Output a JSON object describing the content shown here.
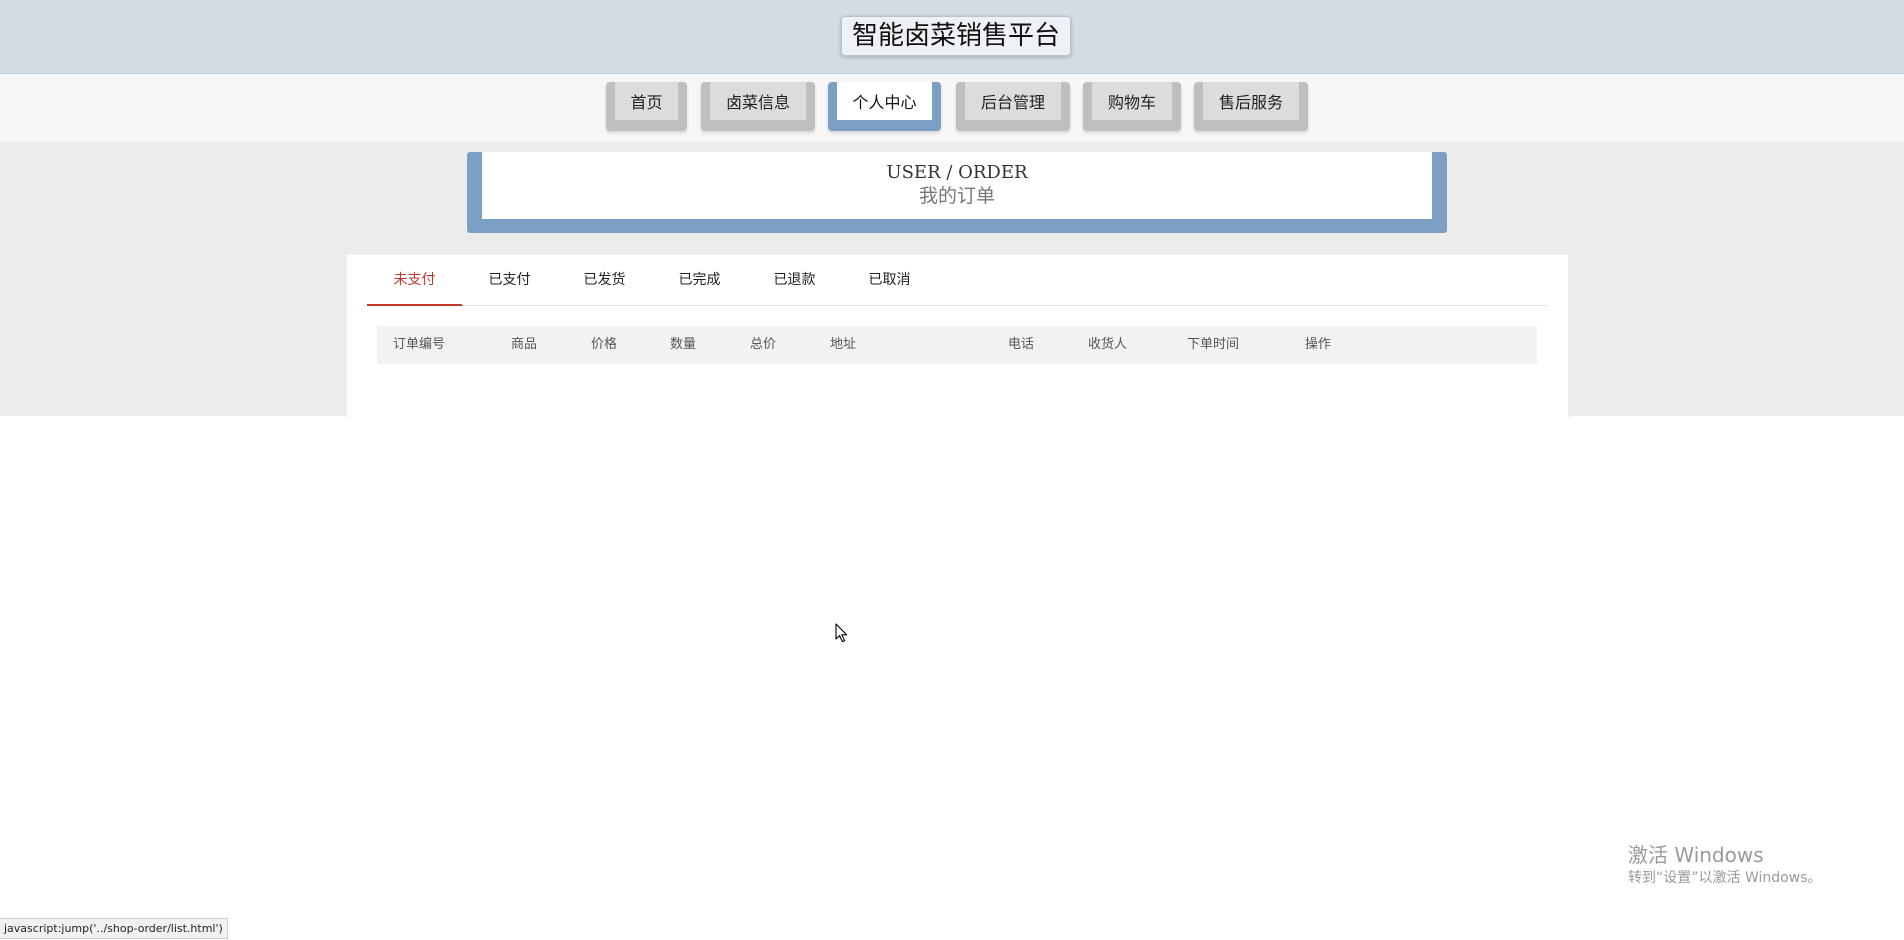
{
  "header": {
    "site_title": "智能卤菜销售平台"
  },
  "nav": {
    "items": [
      {
        "label": "首页"
      },
      {
        "label": "卤菜信息"
      },
      {
        "label": "个人中心"
      },
      {
        "label": "后台管理"
      },
      {
        "label": "购物车"
      },
      {
        "label": "售后服务"
      }
    ],
    "active": "个人中心"
  },
  "section": {
    "title_en": "USER / ORDER",
    "title_zh": "我的订单"
  },
  "orders": {
    "tabs": [
      {
        "label": "未支付"
      },
      {
        "label": "已支付"
      },
      {
        "label": "已发货"
      },
      {
        "label": "已完成"
      },
      {
        "label": "已退款"
      },
      {
        "label": "已取消"
      }
    ],
    "active_tab": "未支付",
    "columns": [
      "订单编号",
      "商品",
      "价格",
      "数量",
      "总价",
      "地址",
      "电话",
      "收货人",
      "下单时间",
      "操作"
    ]
  },
  "watermark": {
    "line1": "激活 Windows",
    "line2": "转到“设置”以激活 Windows。"
  },
  "statusbar": {
    "text": "javascript:jump('../shop-order/list.html')"
  },
  "colors": {
    "accent": "#7c9fc6",
    "active_tab": "#c0392b",
    "header_bg": "#d3dde6"
  }
}
